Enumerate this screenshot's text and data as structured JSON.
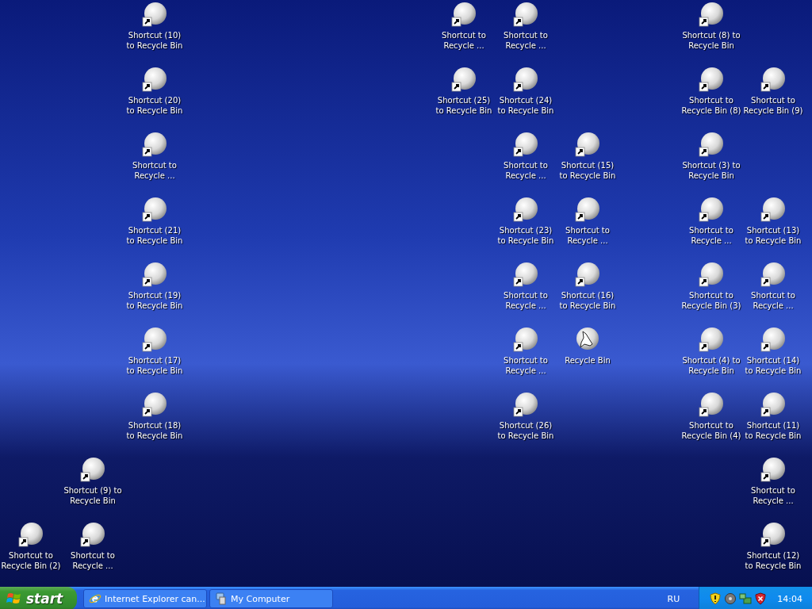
{
  "desktop": {
    "icons": [
      {
        "kind": "shortcut",
        "label": "Shortcut (10) to Recycle Bin"
      },
      {
        "kind": "shortcut",
        "label": "Shortcut to Recycle ..."
      },
      {
        "kind": "shortcut",
        "label": "Shortcut to Recycle ..."
      },
      {
        "kind": "shortcut",
        "label": "Shortcut (8) to Recycle Bin"
      },
      {
        "kind": "shortcut",
        "label": "Shortcut (20) to Recycle Bin"
      },
      {
        "kind": "shortcut",
        "label": "Shortcut (25) to Recycle Bin"
      },
      {
        "kind": "shortcut",
        "label": "Shortcut (24) to Recycle Bin"
      },
      {
        "kind": "shortcut",
        "label": "Shortcut to Recycle Bin (8)"
      },
      {
        "kind": "shortcut",
        "label": "Shortcut to Recycle Bin (9)"
      },
      {
        "kind": "shortcut",
        "label": "Shortcut to Recycle ..."
      },
      {
        "kind": "shortcut",
        "label": "Shortcut to Recycle ..."
      },
      {
        "kind": "shortcut",
        "label": "Shortcut (15) to Recycle Bin"
      },
      {
        "kind": "shortcut",
        "label": "Shortcut (3) to Recycle Bin"
      },
      {
        "kind": "shortcut",
        "label": "Shortcut (21) to Recycle Bin"
      },
      {
        "kind": "shortcut",
        "label": "Shortcut (23) to Recycle Bin"
      },
      {
        "kind": "shortcut",
        "label": "Shortcut to Recycle ..."
      },
      {
        "kind": "shortcut",
        "label": "Shortcut to Recycle ..."
      },
      {
        "kind": "shortcut",
        "label": "Shortcut (13) to Recycle Bin"
      },
      {
        "kind": "shortcut",
        "label": "Shortcut (19) to Recycle Bin"
      },
      {
        "kind": "shortcut",
        "label": "Shortcut to Recycle ..."
      },
      {
        "kind": "shortcut",
        "label": "Shortcut (16) to Recycle Bin"
      },
      {
        "kind": "shortcut",
        "label": "Shortcut to Recycle Bin (3)"
      },
      {
        "kind": "shortcut",
        "label": "Shortcut to Recycle ..."
      },
      {
        "kind": "shortcut",
        "label": "Shortcut (17) to Recycle Bin"
      },
      {
        "kind": "shortcut",
        "label": "Shortcut to Recycle ..."
      },
      {
        "kind": "bin",
        "label": "Recycle Bin"
      },
      {
        "kind": "shortcut",
        "label": "Shortcut (4) to Recycle Bin"
      },
      {
        "kind": "shortcut",
        "label": "Shortcut (14) to Recycle Bin"
      },
      {
        "kind": "shortcut",
        "label": "Shortcut (18) to Recycle Bin"
      },
      {
        "kind": "shortcut",
        "label": "Shortcut (26) to Recycle Bin"
      },
      {
        "kind": "shortcut",
        "label": "Shortcut to Recycle Bin (4)"
      },
      {
        "kind": "shortcut",
        "label": "Shortcut (11) to Recycle Bin"
      },
      {
        "kind": "shortcut",
        "label": "Shortcut (9) to Recycle Bin"
      },
      {
        "kind": "shortcut",
        "label": "Shortcut to Recycle ..."
      },
      {
        "kind": "shortcut",
        "label": "Shortcut to Recycle Bin (2)"
      },
      {
        "kind": "shortcut",
        "label": "Shortcut to Recycle ..."
      },
      {
        "kind": "shortcut",
        "label": "Shortcut (12) to Recycle Bin"
      }
    ]
  },
  "taskbar": {
    "start": "start",
    "tasks": [
      {
        "kind": "browser",
        "label": "Internet Explorer can...",
        "selected": false
      },
      {
        "kind": "computer",
        "label": "My Computer",
        "selected": false
      }
    ],
    "language": "RU",
    "clock": "14:04"
  }
}
